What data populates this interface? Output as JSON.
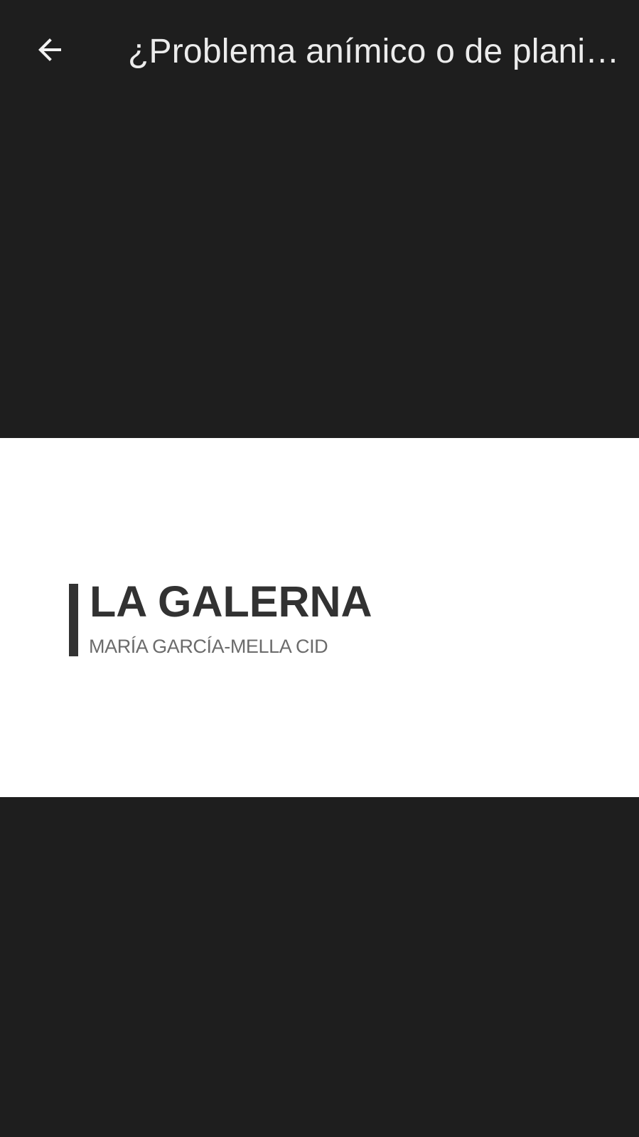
{
  "toolbar": {
    "back_icon": "arrow-left-icon",
    "title": "¿Problema anímico o de plani…"
  },
  "image": {
    "brand_title": "LA GALERNA",
    "brand_subtitle": "MARÍA GARCÍA-MELLA CID"
  },
  "colors": {
    "background": "#1e1e1e",
    "title_text": "#ececec",
    "image_background": "#ffffff",
    "brand_text": "#323232",
    "subtitle_text": "#6b6b6b"
  }
}
